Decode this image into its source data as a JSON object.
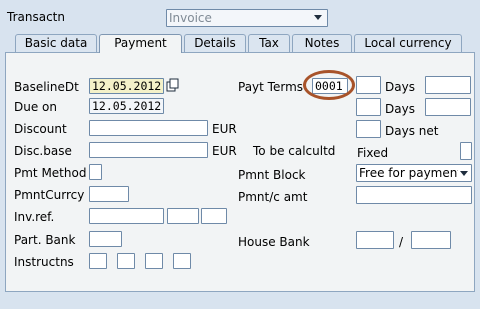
{
  "header": {
    "transaction_label": "Transactn",
    "transaction_value": "Invoice"
  },
  "tabs": [
    {
      "label": "Basic data",
      "active": false
    },
    {
      "label": "Payment",
      "active": true
    },
    {
      "label": "Details",
      "active": false
    },
    {
      "label": "Tax",
      "active": false
    },
    {
      "label": "Notes",
      "active": false
    },
    {
      "label": "Local currency",
      "active": false
    }
  ],
  "form": {
    "baseline_label": "BaselineDt",
    "baseline_value": "12.05.2012",
    "due_on_label": "Due on",
    "due_on_value": "12.05.2012",
    "discount_label": "Discount",
    "discount_value": "",
    "discount_currency": "EUR",
    "disc_base_label": "Disc.base",
    "disc_base_value": "",
    "disc_base_currency": "EUR",
    "to_be_calc_label": "To be calcultd",
    "pmt_method_label": "Pmt Method",
    "pmt_method_value": "",
    "pmnt_currcy_label": "PmntCurrcy",
    "pmnt_currcy_value": "",
    "inv_ref_label": "Inv.ref.",
    "part_bank_label": "Part. Bank",
    "instructns_label": "Instructns",
    "payt_terms_label": "Payt Terms",
    "payt_terms_value": "0001",
    "days_label_1": "Days",
    "days_label_2": "Days",
    "days_net_label": "Days net",
    "fixed_label": "Fixed",
    "pmnt_block_label": "Pmnt Block",
    "pmnt_block_value": "Free for payment",
    "pmnt_c_amt_label": "Pmnt/c amt",
    "house_bank_label": "House Bank",
    "house_bank_separator": "/"
  },
  "colors": {
    "background": "#d8e3ef",
    "panel": "#f2f4f5",
    "highlight_field": "#f4f1c9",
    "annotation_circle": "#a8532a"
  },
  "icons": {
    "dropdown": "chevron-down-icon",
    "copy": "copy-icon"
  }
}
